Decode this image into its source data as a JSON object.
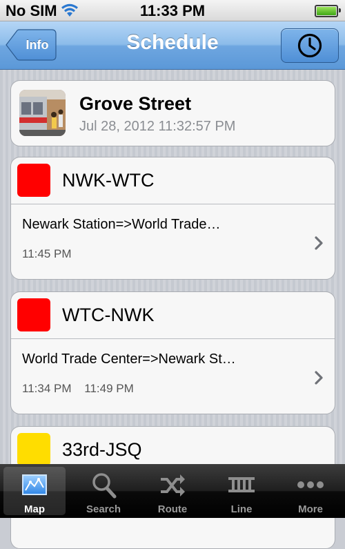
{
  "status_bar": {
    "carrier": "No SIM",
    "time": "11:33 PM"
  },
  "nav": {
    "back_label": "Info",
    "title": "Schedule"
  },
  "station": {
    "name": "Grove Street",
    "datetime": "Jul 28, 2012 11:32:57 PM"
  },
  "routes": [
    {
      "name": "NWK-WTC",
      "color": "#ff0000",
      "destination": "Newark Station=>World Trade…",
      "times": [
        "11:45 PM"
      ]
    },
    {
      "name": "WTC-NWK",
      "color": "#ff0000",
      "destination": "World Trade Center=>Newark St…",
      "times": [
        "11:34 PM",
        "11:49 PM"
      ]
    },
    {
      "name": "33rd-JSQ",
      "color": "#ffdd00",
      "destination": "",
      "times": []
    }
  ],
  "tabs": [
    {
      "label": "Map",
      "icon": "map-icon",
      "selected": true
    },
    {
      "label": "Search",
      "icon": "search-icon",
      "selected": false
    },
    {
      "label": "Route",
      "icon": "shuffle-icon",
      "selected": false
    },
    {
      "label": "Line",
      "icon": "train-line-icon",
      "selected": false
    },
    {
      "label": "More",
      "icon": "more-icon",
      "selected": false
    }
  ]
}
